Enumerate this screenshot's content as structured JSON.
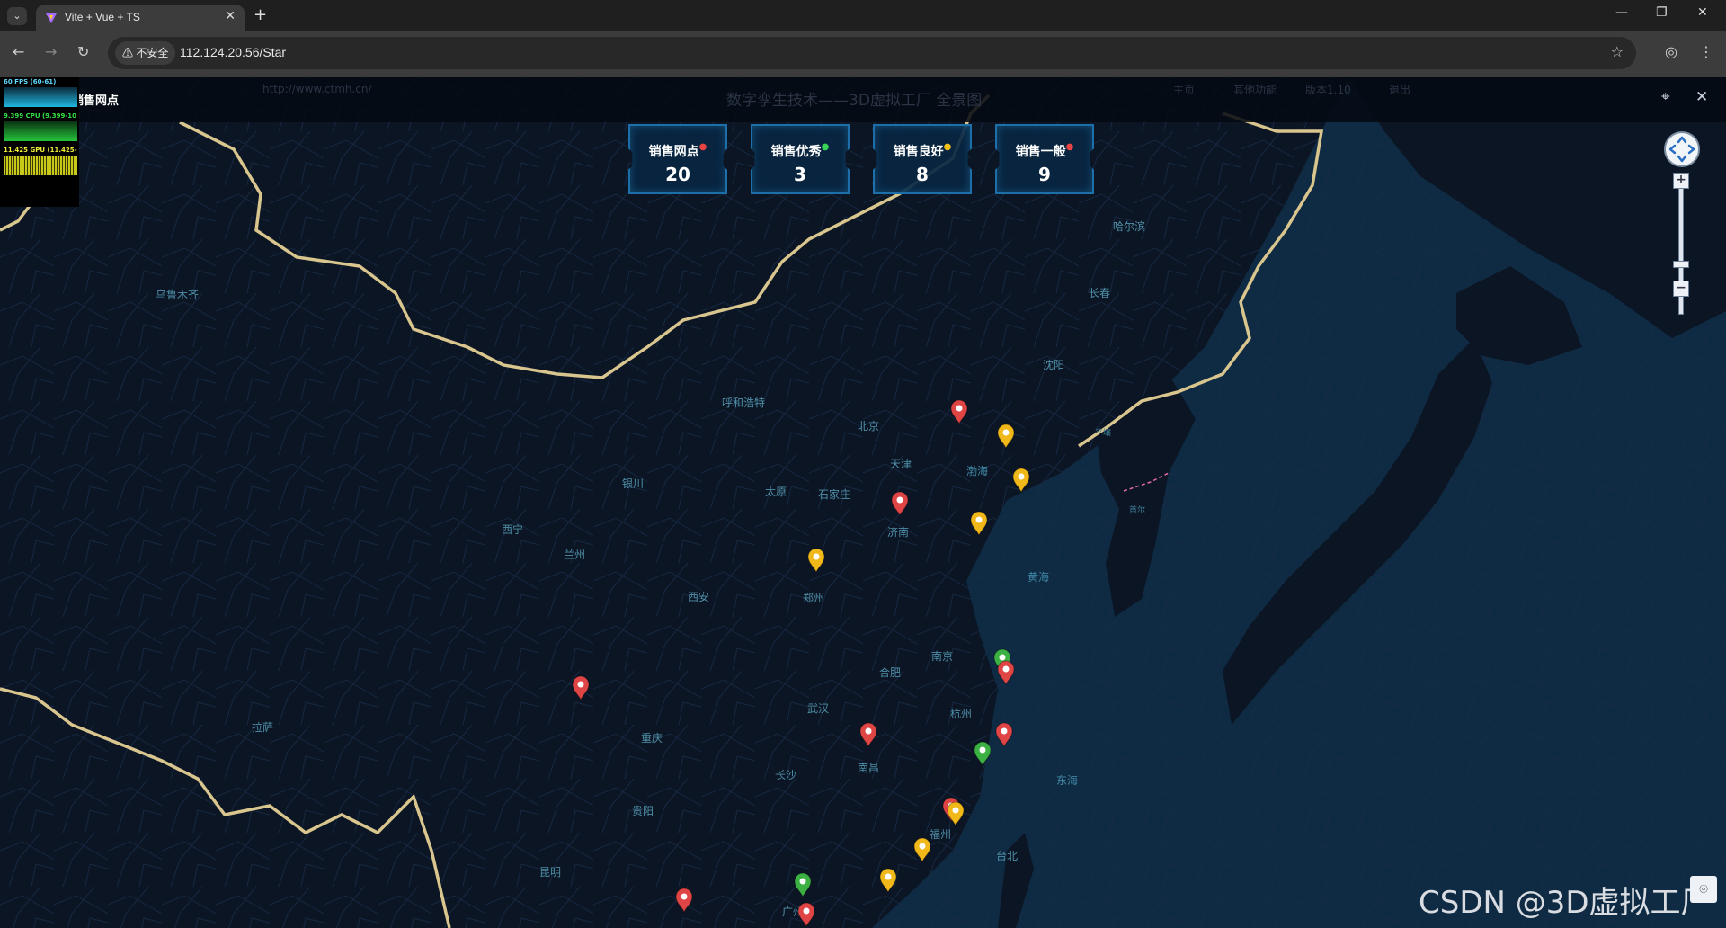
{
  "browser": {
    "tab_title": "Vite + Vue + TS",
    "security_chip": "不安全",
    "url": "112.124.20.56/Star"
  },
  "app": {
    "title": "销售网点",
    "ghost_title": "数字孪生技术——3D虚拟工厂 全景图",
    "ghost_url": "http://www.ctmh.cn/",
    "ghost_nav": [
      "主页",
      "其他功能",
      "版本1.10",
      "退出"
    ]
  },
  "perf_stats": {
    "fps": "60 FPS (60-61)",
    "cpu": "9.399 CPU (9.399-10",
    "gpu": "11.425 GPU (11.425-"
  },
  "cards": [
    {
      "label": "销售网点",
      "value": "20",
      "dot_color": "#e84343"
    },
    {
      "label": "销售优秀",
      "value": "3",
      "dot_color": "#3ad35a"
    },
    {
      "label": "销售良好",
      "value": "8",
      "dot_color": "#f2c21b"
    },
    {
      "label": "销售一般",
      "value": "9",
      "dot_color": "#e84343"
    }
  ],
  "cities": [
    "乌鲁木齐",
    "哈尔滨",
    "长春",
    "沈阳",
    "呼和浩特",
    "北京",
    "天津",
    "石家庄",
    "太原",
    "银川",
    "西宁",
    "兰州",
    "济南",
    "郑州",
    "西安",
    "合肥",
    "南京",
    "武汉",
    "杭州",
    "重庆",
    "拉萨",
    "南昌",
    "长沙",
    "福州",
    "贵阳",
    "昆明",
    "广州",
    "台北",
    "平壤",
    "首尔",
    "渤海",
    "黄海",
    "东海"
  ],
  "marker_colors": {
    "poor": "#e04545",
    "good": "#f1b81a",
    "excellent": "#3cb043"
  },
  "watermark": "CSDN @3D虚拟工厂"
}
